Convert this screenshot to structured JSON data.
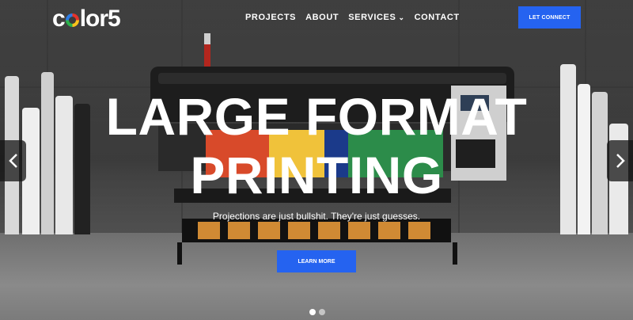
{
  "brand": {
    "logo_text_prefix": "c",
    "logo_text_suffix": "lor5",
    "accent": "#2563f0"
  },
  "nav": {
    "items": [
      {
        "label": "PROJECTS"
      },
      {
        "label": "ABOUT"
      },
      {
        "label": "SERVICES",
        "has_dropdown": true
      },
      {
        "label": "CONTACT"
      }
    ],
    "cta_label": "LET CONNECT"
  },
  "hero": {
    "headline_line1": "LARGE FORMAT",
    "headline_line2": "PRINTING",
    "subtitle": "Projections are just bullshit. They're just guesses.",
    "button_label": "LEARN MORE"
  },
  "slider": {
    "prev_icon": "chevron-left-icon",
    "next_icon": "chevron-right-icon",
    "slide_count": 2,
    "active_slide": 1
  }
}
